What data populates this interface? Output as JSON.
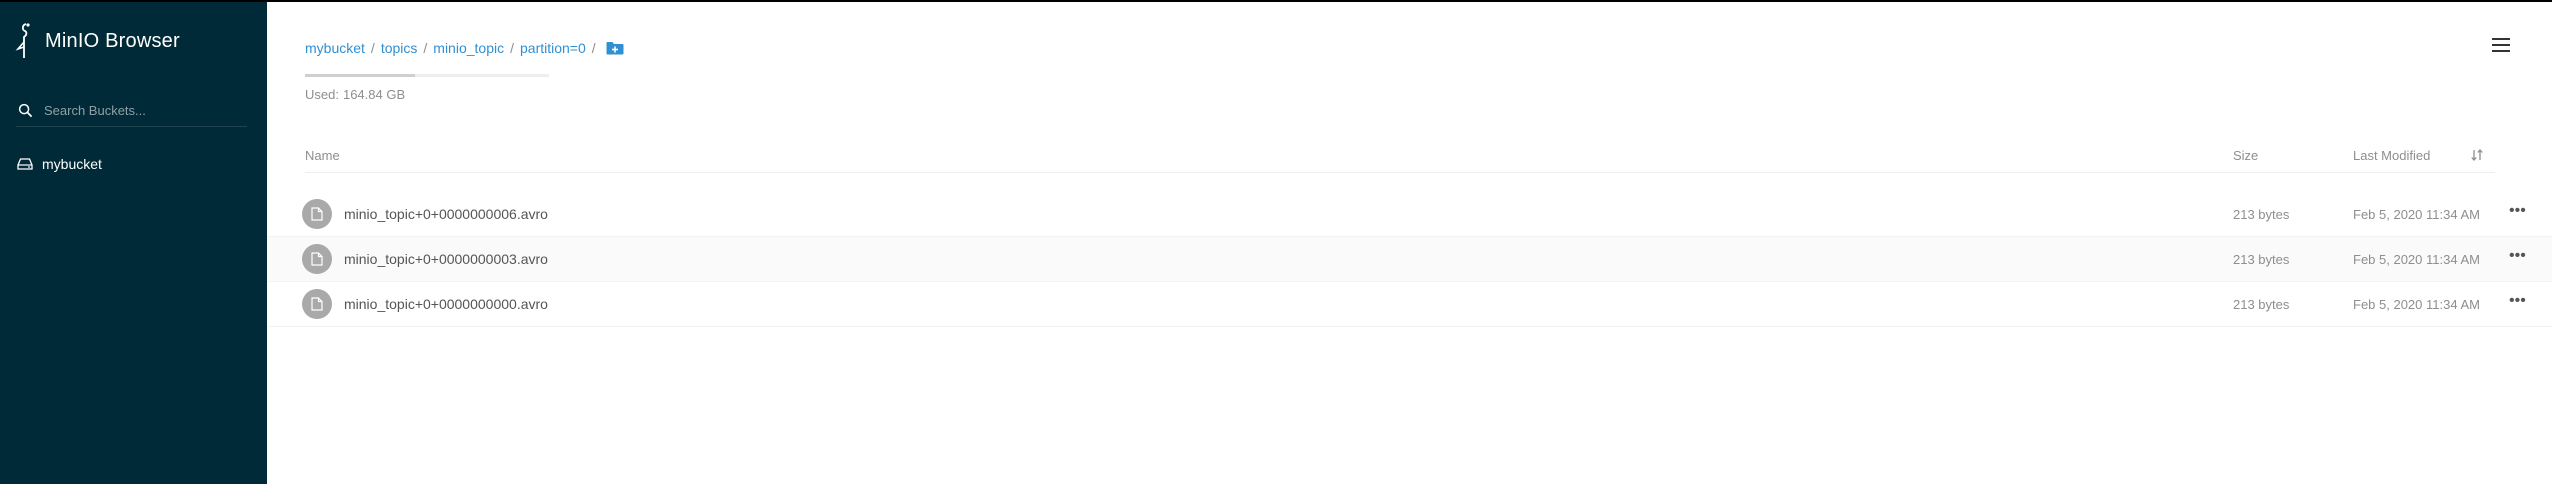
{
  "app": {
    "title": "MinIO Browser"
  },
  "sidebar": {
    "search": {
      "placeholder": "Search Buckets..."
    },
    "buckets": [
      {
        "label": "mybucket"
      }
    ]
  },
  "breadcrumb": {
    "items": [
      "mybucket",
      "topics",
      "minio_topic",
      "partition=0"
    ],
    "separator": "/"
  },
  "storage": {
    "used_label": "Used:",
    "used_value": "164.84 GB",
    "usage_fraction": 0.45
  },
  "table": {
    "columns": {
      "name": "Name",
      "size": "Size",
      "last_modified": "Last Modified"
    },
    "rows": [
      {
        "name": "minio_topic+0+0000000006.avro",
        "size": "213 bytes",
        "modified": "Feb 5, 2020 11:34 AM"
      },
      {
        "name": "minio_topic+0+0000000003.avro",
        "size": "213 bytes",
        "modified": "Feb 5, 2020 11:34 AM"
      },
      {
        "name": "minio_topic+0+0000000000.avro",
        "size": "213 bytes",
        "modified": "Feb 5, 2020 11:34 AM"
      }
    ]
  },
  "icons": {
    "logo": "minio-bird-logo-icon",
    "search": "search-icon",
    "bucket": "hard-drive-icon",
    "folder_add": "folder-plus-icon",
    "menu": "hamburger-menu-icon",
    "sort": "sort-icon",
    "file": "file-icon",
    "more": "ellipsis-icon"
  },
  "colors": {
    "sidebar_bg": "#002a37",
    "link": "#3190d2",
    "file_icon_bg": "#a9a9a9"
  }
}
